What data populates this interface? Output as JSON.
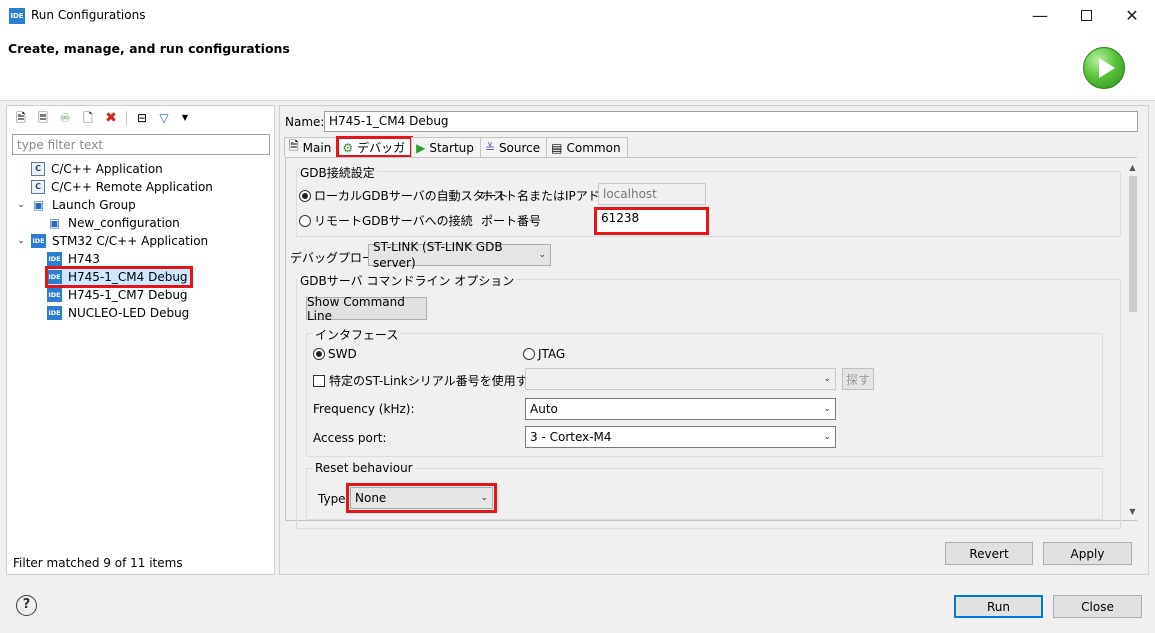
{
  "window": {
    "app_icon": "IDE",
    "title": "Run Configurations",
    "header_title": "Create, manage, and run configurations"
  },
  "left": {
    "filter_placeholder": "type filter text",
    "tree": [
      {
        "label": "C/C++ Application",
        "icon": "c-icon",
        "level": 1,
        "expand": ""
      },
      {
        "label": "C/C++ Remote Application",
        "icon": "c-icon",
        "level": 1,
        "expand": ""
      },
      {
        "label": "Launch Group",
        "icon": "launch-group-icon",
        "level": 0,
        "expand": "v"
      },
      {
        "label": "New_configuration",
        "icon": "launch-group-icon",
        "level": 2,
        "expand": ""
      },
      {
        "label": "STM32 C/C++ Application",
        "icon": "ide-icon",
        "level": 0,
        "expand": "v"
      },
      {
        "label": "H743",
        "icon": "ide-icon",
        "level": 2,
        "expand": ""
      },
      {
        "label": "H745-1_CM4 Debug",
        "icon": "ide-icon",
        "level": 2,
        "expand": "",
        "selected": true
      },
      {
        "label": "H745-1_CM7 Debug",
        "icon": "ide-icon",
        "level": 2,
        "expand": ""
      },
      {
        "label": "NUCLEO-LED Debug",
        "icon": "ide-icon",
        "level": 2,
        "expand": ""
      }
    ],
    "status": "Filter matched 9 of 11 items"
  },
  "right": {
    "name_label": "Name:",
    "name_value": "H745-1_CM4 Debug",
    "tabs": [
      {
        "label": "Main",
        "icon": "main-icon"
      },
      {
        "label": "デバッガ",
        "icon": "debug-icon",
        "active": true
      },
      {
        "label": "Startup",
        "icon": "startup-icon"
      },
      {
        "label": "Source",
        "icon": "source-icon"
      },
      {
        "label": "Common",
        "icon": "common-icon"
      }
    ],
    "gdb_group": "GDB接続設定",
    "radio_local": "ローカルGDBサーバの自動スタート",
    "host_label": "ホスト名またはIPアドレス",
    "host_value": "localhost",
    "radio_remote": "リモートGDBサーバへの接続",
    "port_label": "ポート番号",
    "port_value": "61238",
    "probe_label": "デバッグプローブ",
    "probe_value": "ST-LINK (ST-LINK GDB server)",
    "server_group": "GDBサーバ コマンドライン オプション",
    "show_cmd_btn": "Show Command Line",
    "interface_group": "インタフェース",
    "swd_label": "SWD",
    "jtag_label": "JTAG",
    "serial_check_label": "特定のST-Linkシリアル番号を使用する",
    "search_btn": "探す",
    "freq_label": "Frequency (kHz):",
    "freq_value": "Auto",
    "access_label": "Access port:",
    "access_value": "3 - Cortex-M4",
    "reset_group": "Reset behaviour",
    "type_label": "Type:",
    "type_value": "None",
    "revert_btn": "Revert",
    "apply_btn": "Apply"
  },
  "footer": {
    "run_btn": "Run",
    "close_btn": "Close"
  }
}
